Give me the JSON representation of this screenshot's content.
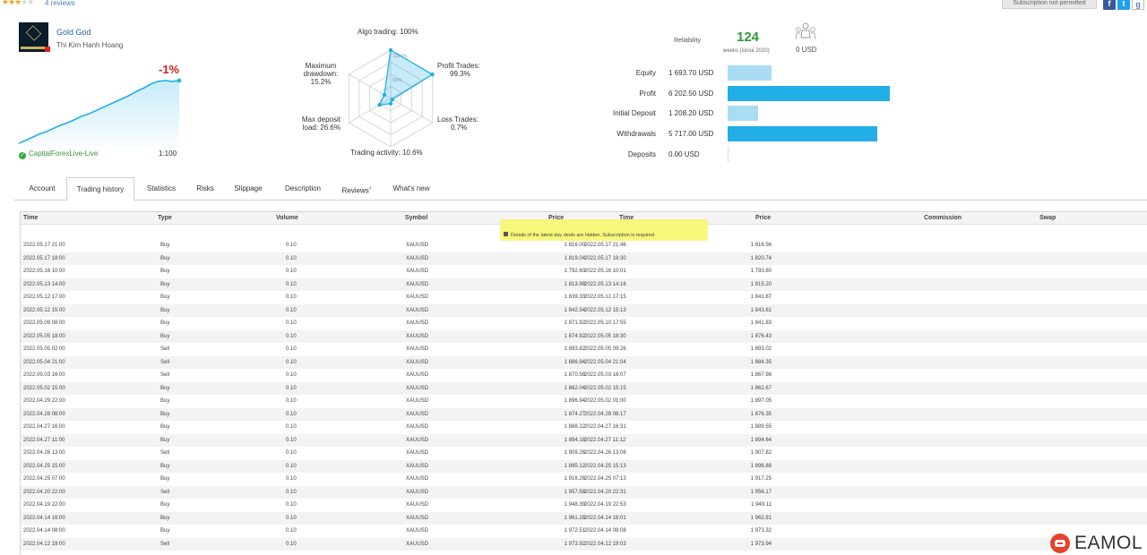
{
  "top": {
    "stars": "★★★",
    "stars_off": "★★",
    "reviews": "4 reviews",
    "subscription": "Subscription not permitted",
    "social": [
      "f",
      "t",
      "g"
    ]
  },
  "signal": {
    "name": "Gold God",
    "author": "Thi Kim Hanh Hoang",
    "growth": "-1%",
    "broker": "CapitalForexLive-Live",
    "leverage": "1:100",
    "curve": [
      2,
      6,
      10,
      14,
      17,
      21,
      25,
      28,
      32,
      36,
      39,
      43,
      47,
      51,
      55,
      59,
      63,
      68,
      72,
      77,
      80,
      81,
      80,
      81
    ]
  },
  "radar": {
    "algo": "Algo trading: 100%",
    "profit_trades": [
      "Profit Trades:",
      "99.3%"
    ],
    "loss_trades": [
      "Loss Trades:",
      "0.7%"
    ],
    "activity": "Trading activity: 10.6%",
    "deposit_load": [
      "Max deposit",
      "load: 26.6%"
    ],
    "drawdown": [
      "Maximum",
      "drawdown:",
      "15.2%"
    ],
    "ring_100": "100+%",
    "ring_50": "50%",
    "values": [
      100,
      99.3,
      0.7,
      10.6,
      26.6,
      15.2
    ]
  },
  "reliability": {
    "label": "Reliability",
    "weeks": "124",
    "weeks_sub": "weeks (since 2020)",
    "subscribers": "0 USD"
  },
  "stats": [
    {
      "label": "Equity",
      "value": "1 693.70 USD",
      "bar": 0.27,
      "color": "#a9ddf3"
    },
    {
      "label": "Profit",
      "value": "6 202.50 USD",
      "bar": 1.0,
      "color": "#22aee6"
    },
    {
      "label": "Initial Deposit",
      "value": "1 208.20 USD",
      "bar": 0.19,
      "color": "#a9ddf3"
    },
    {
      "label": "Withdrawals",
      "value": "5 717.00 USD",
      "bar": 0.92,
      "color": "#22aee6"
    },
    {
      "label": "Deposits",
      "value": "0.00 USD",
      "bar": 0.0,
      "color": "#22aee6"
    }
  ],
  "tabs": [
    "Account",
    "Trading history",
    "Statistics",
    "Risks",
    "Slippage",
    "Description",
    "Reviews",
    "What's new"
  ],
  "reviews_sup": "4",
  "table": {
    "headers": [
      "Time",
      "Type",
      "Volume",
      "Symbol",
      "Price",
      "Time",
      "Price",
      "Commission",
      "Swap"
    ],
    "hidden_note": "Details of the latest day deals are hidden. Subscription is required",
    "rows": [
      [
        "2022.05.17 21:00",
        "Buy",
        "0.10",
        "XAUUSD",
        "1 816.00",
        "2022.05.17 21:46",
        "1 816.56"
      ],
      [
        "2022.05.17 18:00",
        "Buy",
        "0.10",
        "XAUUSD",
        "1 819.04",
        "2022.05.17 18:30",
        "1 820.74"
      ],
      [
        "2022.05.16 10:00",
        "Buy",
        "0.10",
        "XAUUSD",
        "1 792.60",
        "2022.05.16 10:01",
        "1 793.80"
      ],
      [
        "2022.05.13 14:00",
        "Buy",
        "0.10",
        "XAUUSD",
        "1 813.98",
        "2022.05.13 14:16",
        "1 815.20"
      ],
      [
        "2022.05.12 17:00",
        "Buy",
        "0.10",
        "XAUUSD",
        "1 839.33",
        "2022.05.12 17:15",
        "1 841.87"
      ],
      [
        "2022.05.12 15:00",
        "Buy",
        "0.10",
        "XAUUSD",
        "1 842.54",
        "2022.05.12 15:13",
        "1 843.61"
      ],
      [
        "2022.05.09 08:00",
        "Buy",
        "0.10",
        "XAUUSD",
        "1 871.92",
        "2022.05.10 17:55",
        "1 841.83"
      ],
      [
        "2022.05.05 18:00",
        "Buy",
        "0.10",
        "XAUUSD",
        "1 874.92",
        "2022.05.05 18:30",
        "1 876.43"
      ],
      [
        "2022.05.05 02:00",
        "Sell",
        "0.10",
        "XAUUSD",
        "1 893.82",
        "2022.05.05 09:26",
        "1 893.02"
      ],
      [
        "2022.05.04 21:00",
        "Sell",
        "0.10",
        "XAUUSD",
        "1 886.94",
        "2022.05.04 21:04",
        "1 884.35"
      ],
      [
        "2022.05.03 16:00",
        "Sell",
        "0.10",
        "XAUUSD",
        "1 870.58",
        "2022.05.03 16:07",
        "1 867.98"
      ],
      [
        "2022.05.02 15:00",
        "Buy",
        "0.10",
        "XAUUSD",
        "1 862.04",
        "2022.05.02 15:15",
        "1 862.67"
      ],
      [
        "2022.04.29 22:00",
        "Buy",
        "0.10",
        "XAUUSD",
        "1 896.94",
        "2022.05.02 01:00",
        "1 897.05"
      ],
      [
        "2022.04.28 08:00",
        "Buy",
        "0.10",
        "XAUUSD",
        "1 874.27",
        "2022.04.28 08:17",
        "1 876.35"
      ],
      [
        "2022.04.27 16:00",
        "Buy",
        "0.10",
        "XAUUSD",
        "1 888.22",
        "2022.04.27 16:31",
        "1 889.55"
      ],
      [
        "2022.04.27 11:00",
        "Buy",
        "0.10",
        "XAUUSD",
        "1 894.18",
        "2022.04.27 11:12",
        "1 894.64"
      ],
      [
        "2022.04.26 13:00",
        "Sell",
        "0.10",
        "XAUUSD",
        "1 909.26",
        "2022.04.26 13:06",
        "1 907.82"
      ],
      [
        "2022.04.25 15:00",
        "Buy",
        "0.10",
        "XAUUSD",
        "1 895.12",
        "2022.04.25 15:13",
        "1 896.88"
      ],
      [
        "2022.04.25 07:00",
        "Buy",
        "0.10",
        "XAUUSD",
        "1 916.26",
        "2022.04.25 07:13",
        "1 917.25"
      ],
      [
        "2022.04.20 22:00",
        "Sell",
        "0.10",
        "XAUUSD",
        "1 957.58",
        "2022.04.20 22:31",
        "1 956.17"
      ],
      [
        "2022.04.19 22:00",
        "Buy",
        "0.10",
        "XAUUSD",
        "1 948.39",
        "2022.04.19 22:53",
        "1 949.11"
      ],
      [
        "2022.04.14 16:00",
        "Buy",
        "0.10",
        "XAUUSD",
        "1 961.28",
        "2022.04.14 16:01",
        "1 962.81"
      ],
      [
        "2022.04.14 08:00",
        "Buy",
        "0.10",
        "XAUUSD",
        "1 972.51",
        "2022.04.14 08:08",
        "1 973.32"
      ],
      [
        "2022.04.12 19:00",
        "Sell",
        "0.10",
        "XAUUSD",
        "1 973.92",
        "2022.04.12 19:03",
        "1 973.94"
      ]
    ]
  },
  "brand": "EAMOL",
  "colors": {
    "accent": "#22aee6",
    "accent_light": "#a9ddf3",
    "growth_negative": "#d02020",
    "weeks": "#2f9a3b",
    "highlight": "#f7f77b",
    "brand_red": "#e7412a"
  }
}
